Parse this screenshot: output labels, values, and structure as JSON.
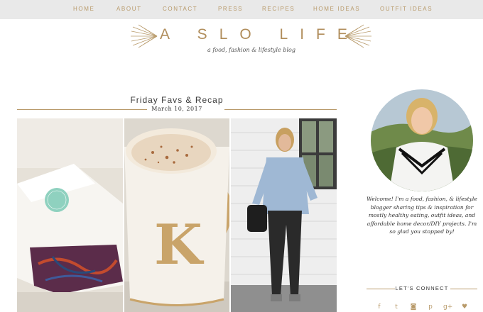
{
  "nav": {
    "items": [
      {
        "label": "HOME"
      },
      {
        "label": "ABOUT"
      },
      {
        "label": "CONTACT"
      },
      {
        "label": "PRESS"
      },
      {
        "label": "RECIPES"
      },
      {
        "label": "HOME IDEAS"
      },
      {
        "label": "OUTFIT IDEAS"
      }
    ]
  },
  "logo": {
    "title": "A SLO LIFE",
    "tagline": "a food, fashion & lifestyle blog"
  },
  "post": {
    "title": "Friday Favs & Recap",
    "date": "March 10, 2017"
  },
  "sidebar": {
    "bio": "Welcome! I'm a food, fashion, & lifestyle blogger sharing tips & inspiration for mostly healthy eating, outfit ideas, and affordable home decor/DIY projects. I'm so glad you stopped by!",
    "connect_label": "LET'S CONNECT",
    "social": [
      {
        "icon": "facebook-icon",
        "glyph": "f"
      },
      {
        "icon": "twitter-icon",
        "glyph": "t"
      },
      {
        "icon": "instagram-icon",
        "glyph": "◙"
      },
      {
        "icon": "pinterest-icon",
        "glyph": "p"
      },
      {
        "icon": "google-plus-icon",
        "glyph": "g+"
      },
      {
        "icon": "heart-icon",
        "glyph": "♥"
      }
    ]
  },
  "colors": {
    "accent": "#b89a6a",
    "nav_bg": "#e9e9e9"
  }
}
